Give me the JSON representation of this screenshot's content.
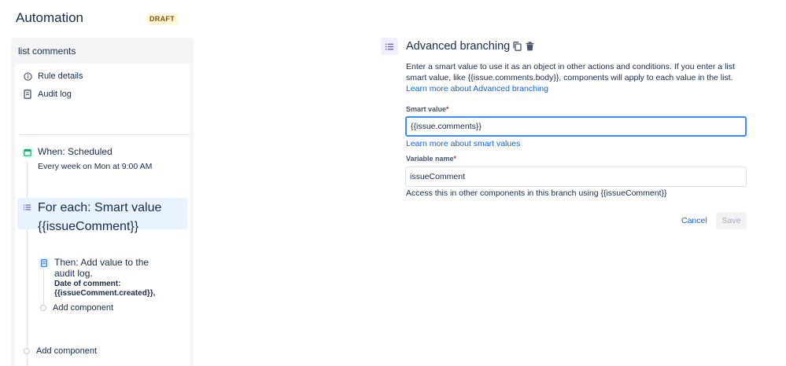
{
  "header": {
    "title": "Automation",
    "badge": "DRAFT"
  },
  "sidebar": {
    "title": "list comments",
    "nav": [
      {
        "label": "Rule details",
        "icon": "info-icon"
      },
      {
        "label": "Audit log",
        "icon": "document-icon"
      }
    ],
    "steps": {
      "trigger": {
        "title": "When: Scheduled",
        "subtitle": "Every week on Mon at 9:00 AM",
        "icon": "calendar-icon",
        "color": "#22a06b"
      },
      "foreach": {
        "title": "For each: Smart value",
        "value": "{{issueComment}}",
        "icon": "branch-list-icon",
        "color": "#6e5dc6"
      },
      "action": {
        "title_line1": "Then: Add value to the",
        "title_line2": "audit log.",
        "detail_line1": "Date of comment:",
        "detail_line2": "{{issueComment.created}},",
        "icon": "document-icon",
        "color": "#1d7afc"
      },
      "add_inner": "Add component",
      "add_outer": "Add component"
    }
  },
  "panel": {
    "title": "Advanced branching",
    "description": "Enter a smart value to use it as an object in other actions and conditions. If you enter a list smart value, like {{issue.comments.body}}, components will apply to each value in the list.",
    "learn_branching": "Learn more about Advanced branching",
    "smart_value": {
      "label": "Smart value",
      "required": "*",
      "value": "{{issue.comments}}",
      "link": "Learn more about smart values"
    },
    "variable_name": {
      "label": "Variable name",
      "required": "*",
      "value": "issueComment",
      "helper": "Access this in other components in this branch using {{issueComment}}"
    },
    "cancel": "Cancel",
    "save": "Save"
  },
  "colors": {
    "accent": "#0c66e4",
    "selected_bg": "#e9f2ff",
    "focus_border": "#388bff"
  }
}
